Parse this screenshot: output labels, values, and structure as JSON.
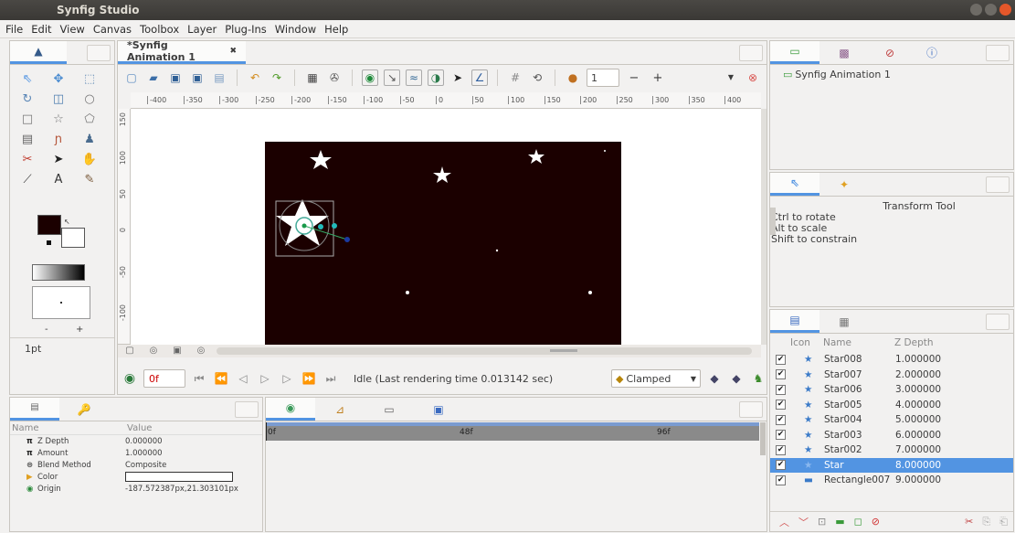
{
  "app": {
    "title": "Synfig Studio"
  },
  "menu": [
    "File",
    "Edit",
    "View",
    "Canvas",
    "Toolbox",
    "Layer",
    "Plug-Ins",
    "Window",
    "Help"
  ],
  "canvas_tab": {
    "title": "*Synfig Animation 1"
  },
  "ruler_h": [
    "-400",
    "-350",
    "-300",
    "-250",
    "-200",
    "-150",
    "-100",
    "-50",
    "0",
    "50",
    "100",
    "150",
    "200",
    "250",
    "300",
    "350",
    "400"
  ],
  "ruler_v": [
    "150",
    "100",
    "50",
    "0",
    "-50",
    "-100"
  ],
  "toolbar": {
    "frame_value": "1",
    "minus": "−",
    "plus": "+"
  },
  "toolbox": {
    "brush_size": "1pt",
    "minus": "-",
    "plus": "+"
  },
  "timebar": {
    "current_time": "0f",
    "status": "Idle (Last rendering time 0.013142 sec)",
    "interpolation": "Clamped"
  },
  "canvas_browser": {
    "item": "Synfig Animation 1"
  },
  "tool_options": {
    "title": "Transform Tool",
    "lines": [
      "Ctrl to rotate",
      "Alt to scale",
      "Shift to constrain"
    ]
  },
  "params": {
    "headers": {
      "name": "Name",
      "value": "Value"
    },
    "rows": [
      {
        "icon": "pi-icon",
        "name": "Z Depth",
        "value": "0.000000"
      },
      {
        "icon": "pi-icon",
        "name": "Amount",
        "value": "1.000000"
      },
      {
        "icon": "blend-icon",
        "name": "Blend Method",
        "value": "Composite"
      },
      {
        "icon": "color-icon",
        "name": "Color",
        "value": ""
      },
      {
        "icon": "origin-icon",
        "name": "Origin",
        "value": "-187.572387px,21.303101px"
      }
    ]
  },
  "timetrack": {
    "marks": [
      "0f",
      "48f",
      "96f"
    ]
  },
  "layers": {
    "headers": {
      "icon": "Icon",
      "name": "Name",
      "zdepth": "Z Depth"
    },
    "rows": [
      {
        "name": "Star008",
        "z": "1.000000",
        "selected": false
      },
      {
        "name": "Star007",
        "z": "2.000000",
        "selected": false
      },
      {
        "name": "Star006",
        "z": "3.000000",
        "selected": false
      },
      {
        "name": "Star005",
        "z": "4.000000",
        "selected": false
      },
      {
        "name": "Star004",
        "z": "5.000000",
        "selected": false
      },
      {
        "name": "Star003",
        "z": "6.000000",
        "selected": false
      },
      {
        "name": "Star002",
        "z": "7.000000",
        "selected": false
      },
      {
        "name": "Star",
        "z": "8.000000",
        "selected": true
      },
      {
        "name": "Rectangle007",
        "z": "9.000000",
        "selected": false
      }
    ]
  },
  "colors": {
    "accent": "#5294e2",
    "canvas": "#1b0000",
    "titlebar": "#3e3c39"
  }
}
